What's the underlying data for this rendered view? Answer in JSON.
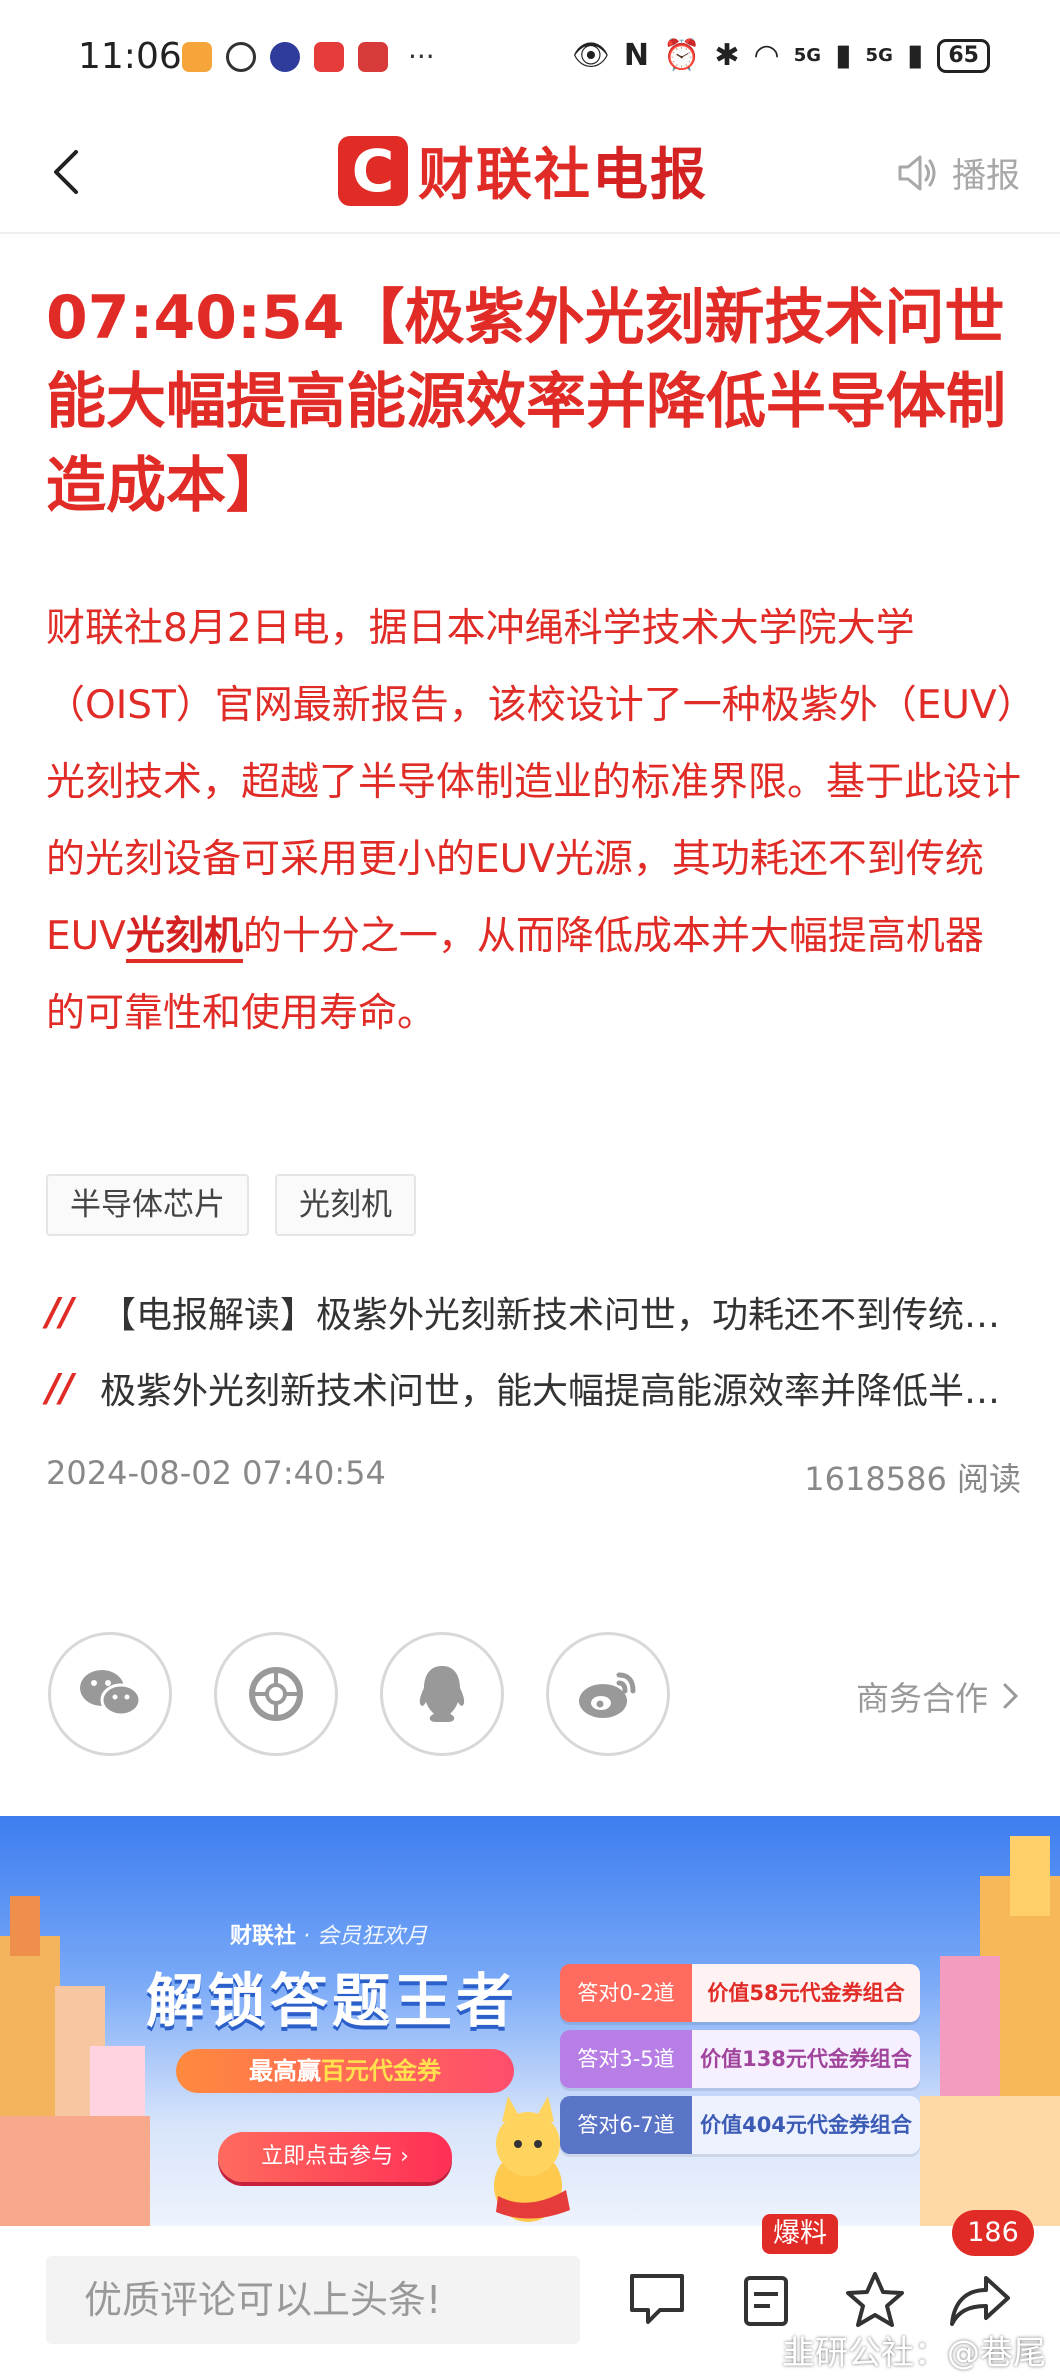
{
  "status_bar": {
    "time": "11:06",
    "more": "···",
    "network_5g_a": "5G",
    "network_5g_b": "5G",
    "battery": "65"
  },
  "nav": {
    "logo_mark": "C",
    "logo_text_a": "财联社",
    "logo_text_b": "电报",
    "broadcast_label": "播报"
  },
  "article": {
    "headline": "07:40:54【极紫外光刻新技术问世 能大幅提高能源效率并降低半导体制造成本】",
    "body_before": "财联社8月2日电，据日本冲绳科学技术大学院大学（OIST）官网最新报告，该校设计了一种极紫外（EUV）光刻技术，超越了半导体制造业的标准界限。基于此设计的光刻设备可采用更小的EUV光源，其功耗还不到传统EUV",
    "body_keyword": "光刻机",
    "body_after": "的十分之一，从而降低成本并大幅提高机器的可靠性和使用寿命。",
    "tags": [
      "半导体芯片",
      "光刻机"
    ],
    "related_mark": "//",
    "related": [
      "【电报解读】极紫外光刻新技术问世，功耗还不到传统EUV光刻机的十分之一",
      "极紫外光刻新技术问世，能大幅提高能源效率并降低半导体制造成本"
    ],
    "datetime": "2024-08-02 07:40:54",
    "reads": "1618586 阅读"
  },
  "share": {
    "icons": [
      "wechat-icon",
      "moments-icon",
      "qq-icon",
      "weibo-icon"
    ],
    "business_label": "商务合作"
  },
  "banner": {
    "brand_a": "财联社",
    "brand_b": "· 会员狂欢月",
    "title": "解锁答题王者",
    "pill_a": "最高赢",
    "pill_b": "百元代金券",
    "cta": "立即点击参与 ›",
    "rows": [
      {
        "q": "答对0-2道",
        "v": "价值58元代金券组合"
      },
      {
        "q": "答对3-5道",
        "v": "价值138元代金券组合"
      },
      {
        "q": "答对6-7道",
        "v": "价值404元代金券组合"
      }
    ]
  },
  "bottom_bar": {
    "comment_placeholder": "优质评论可以上头条!",
    "scoop_badge": "爆料",
    "share_count": "186",
    "watermark": "韭研公社：@巷尾"
  },
  "colors": {
    "accent": "#e02b26",
    "gray_text": "#888888"
  }
}
